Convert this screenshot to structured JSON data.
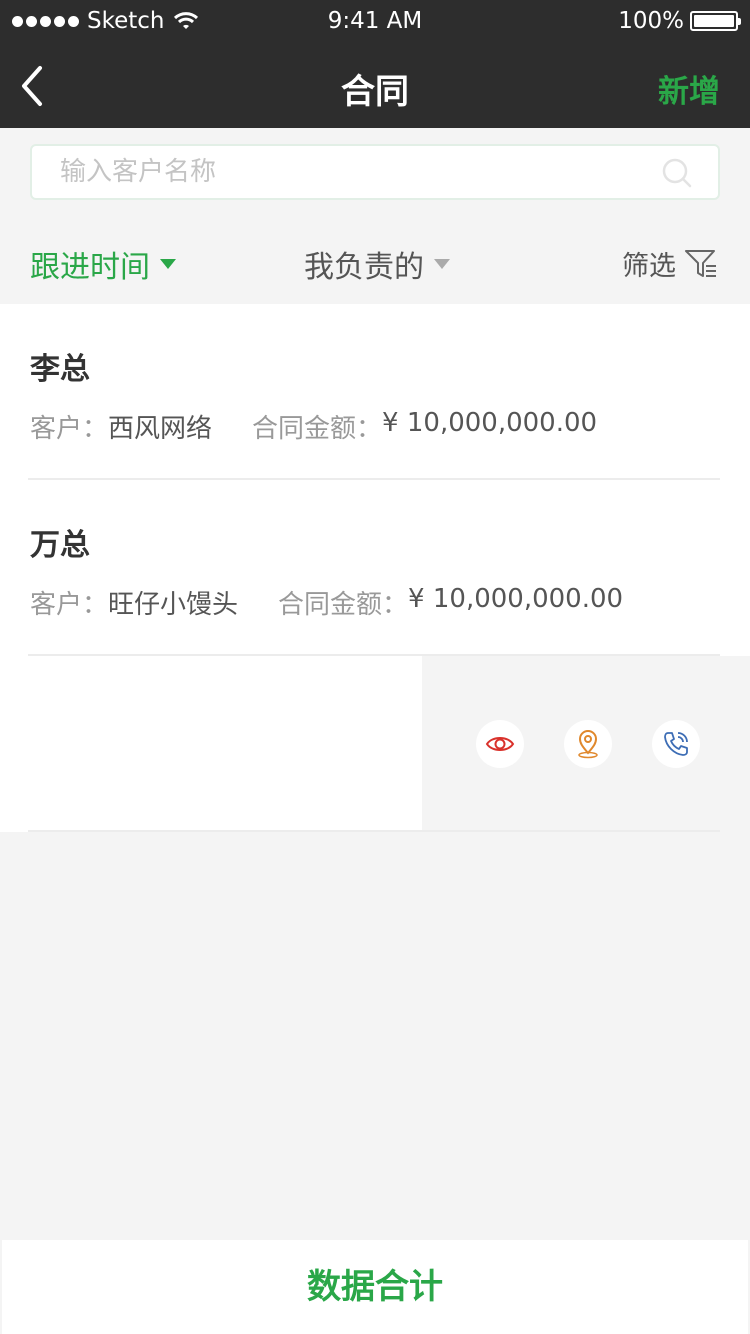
{
  "status_bar": {
    "carrier": "Sketch",
    "time": "9:41 AM",
    "battery": "100%"
  },
  "nav": {
    "title": "合同",
    "add_label": "新增",
    "back_icon": "chevron-left-icon"
  },
  "search": {
    "placeholder": "输入客户名称",
    "value": "",
    "icon": "search-icon"
  },
  "filters": {
    "follow_time": "跟进时间",
    "mine": "我负责的",
    "screen": "筛选",
    "active_color": "#2aa748"
  },
  "contracts": [
    {
      "name": "李总",
      "customer_label": "客户：",
      "customer": "西风网络",
      "amount_label": "合同金额：",
      "amount": "¥ 10,000,000.00"
    },
    {
      "name": "万总",
      "customer_label": "客户：",
      "customer": "旺仔小馒头",
      "amount_label": "合同金额：",
      "amount": "¥ 10,000,000.00"
    }
  ],
  "swipe_actions": [
    {
      "icon": "eye-icon",
      "color": "#d9312b"
    },
    {
      "icon": "location-pin-icon",
      "color": "#e0882c"
    },
    {
      "icon": "phone-icon",
      "color": "#3d6db5"
    }
  ],
  "footer": {
    "summary_label": "数据合计"
  }
}
